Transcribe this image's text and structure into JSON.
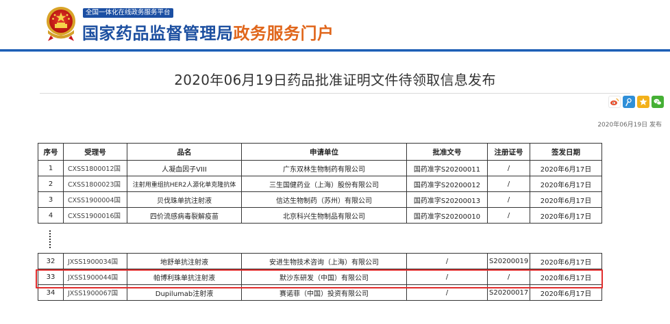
{
  "header": {
    "badge": "全国一体化在线政务服务平台",
    "title_main": "国家药品监督管理局",
    "title_sub": "政务服务门户"
  },
  "page": {
    "title": "2020年06月19日药品批准证明文件待领取信息发布",
    "publish_date": "2020年06月19日 发布"
  },
  "share_icons": [
    "weibo-icon",
    "tencent-weibo-icon",
    "qzone-icon",
    "wechat-icon"
  ],
  "table": {
    "columns": [
      "序号",
      "受理号",
      "品名",
      "申请单位",
      "批准文号",
      "注册证号",
      "签发日期"
    ],
    "rows_top": [
      [
        "1",
        "CXSS1800012国",
        "人凝血因子VIII",
        "广东双林生物制药有限公司",
        "国药准字S20200011",
        "/",
        "2020年6月17日"
      ],
      [
        "2",
        "CXSS1800023国",
        "注射用重组抗HER2人源化单克隆抗体",
        "三生国健药业（上海）股份有限公司",
        "国药准字S20200012",
        "/",
        "2020年6月17日"
      ],
      [
        "3",
        "CXSS1900004国",
        "贝伐珠单抗注射液",
        "信达生物制药（苏州）有限公司",
        "国药准字S20200013",
        "/",
        "2020年6月17日"
      ],
      [
        "4",
        "CXSS1900016国",
        "四价流感病毒裂解疫苗",
        "北京科兴生物制品有限公司",
        "国药准字S20200010",
        "/",
        "2020年6月17日"
      ]
    ],
    "rows_bottom": [
      [
        "32",
        "JXSS1900034国",
        "地舒单抗注射液",
        "安进生物技术咨询（上海）有限公司",
        "/",
        "S20200019",
        "2020年6月17日"
      ],
      [
        "33",
        "JXSS1900044国",
        "帕博利珠单抗注射液",
        "默沙东研发（中国）有限公司",
        "/",
        "/",
        "2020年6月17日"
      ],
      [
        "34",
        "JXSS1900067国",
        "Dupilumab注射液",
        "赛诺菲（中国）投资有限公司",
        "/",
        "S20200017",
        "2020年6月17日"
      ]
    ]
  },
  "colors": {
    "brand_blue": "#1c4fa0",
    "brand_orange": "#e0661b",
    "highlight_red": "#e02b2b",
    "weibo": "#e6502f",
    "tencent_weibo": "#2f8fd8",
    "qzone": "#f3b11a",
    "wechat": "#45b035"
  }
}
